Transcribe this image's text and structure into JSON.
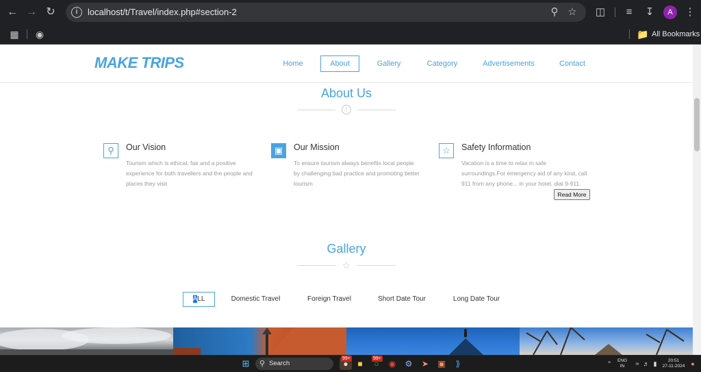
{
  "browser": {
    "url": "localhost/t/Travel/index.php#section-2",
    "bookmarks_label": "All Bookmarks",
    "profile_initial": "A"
  },
  "site": {
    "logo": "MAKE TRIPS",
    "menu": [
      "Home",
      "About",
      "Gallery",
      "Category",
      "Advertisements",
      "Contact"
    ],
    "active_menu": "About"
  },
  "about": {
    "title": "About Us",
    "features": [
      {
        "icon": "map-pin-icon",
        "title": "Our Vision",
        "text": [
          "Tourism which is ethical, fair and a positive",
          "experience for both travellers and the people and",
          "places they visit"
        ]
      },
      {
        "icon": "shield-icon",
        "title": "Our Mission",
        "text": [
          "To ensure tourism always benefits local people",
          "by challenging bad practice and promoting better",
          "tourism"
        ]
      },
      {
        "icon": "star-icon",
        "title": "Safety Information",
        "text": [
          "Vacation is a time to relax in safe",
          "surroundings.For emergency aid of any kind, call",
          "911 from any phone... in your hotel, dial 9-911."
        ]
      }
    ],
    "read_more": "Read More"
  },
  "gallery": {
    "title": "Gallery",
    "filters": [
      "ALL",
      "Domestic Travel",
      "Foreign Travel",
      "Short Date Tour",
      "Long Date Tour"
    ],
    "all_parts": [
      "A",
      "LL"
    ]
  },
  "taskbar": {
    "search_label": "Search",
    "badge_1": "99+",
    "badge_2": "99+",
    "lang_1": "ENG",
    "lang_2": "IN",
    "time": "20:51",
    "date": "27-11-2024"
  },
  "colors": {
    "accent": "#4aa3df",
    "browser_dark": "#202124"
  }
}
